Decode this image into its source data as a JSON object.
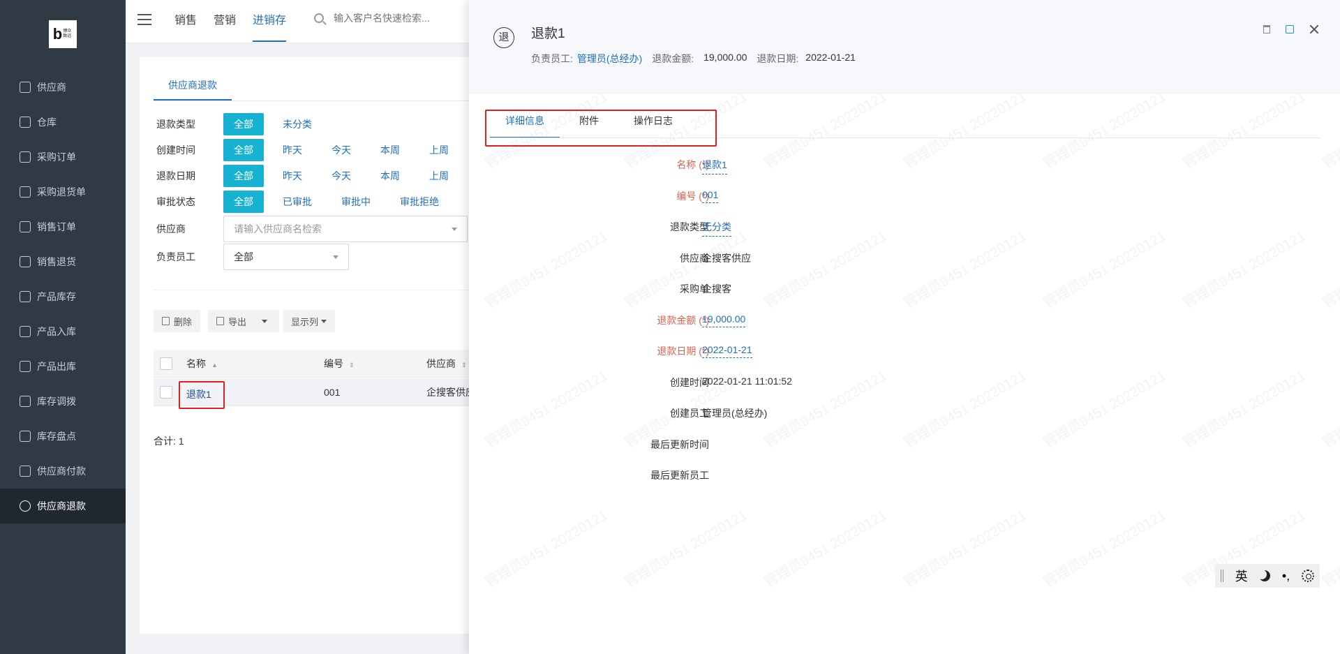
{
  "logo": {
    "mark": "b",
    "text": "博众\n致远"
  },
  "sidebar": {
    "items": [
      {
        "label": "供应商"
      },
      {
        "label": "仓库"
      },
      {
        "label": "采购订单"
      },
      {
        "label": "采购退货单"
      },
      {
        "label": "销售订单"
      },
      {
        "label": "销售退货"
      },
      {
        "label": "产品库存"
      },
      {
        "label": "产品入库"
      },
      {
        "label": "产品出库"
      },
      {
        "label": "库存调拨"
      },
      {
        "label": "库存盘点"
      },
      {
        "label": "供应商付款"
      },
      {
        "label": "供应商退款"
      }
    ],
    "active_index": 12
  },
  "topbar": {
    "tabs": [
      {
        "label": "销售"
      },
      {
        "label": "营销"
      },
      {
        "label": "进销存"
      }
    ],
    "active_tab": 2,
    "search_placeholder": "输入客户名快速检索..."
  },
  "page": {
    "tab_label": "供应商退款",
    "filters": {
      "refund_type": {
        "label": "退款类型",
        "options": [
          "全部",
          "未分类"
        ]
      },
      "created_time": {
        "label": "创建时间",
        "options": [
          "全部",
          "昨天",
          "今天",
          "本周",
          "上周"
        ]
      },
      "refund_date": {
        "label": "退款日期",
        "options": [
          "全部",
          "昨天",
          "今天",
          "本周",
          "上周"
        ]
      },
      "approval_status": {
        "label": "审批状态",
        "options": [
          "全部",
          "已审批",
          "审批中",
          "审批拒绝"
        ]
      },
      "supplier": {
        "label": "供应商",
        "placeholder": "请输入供应商名检索"
      },
      "owner": {
        "label": "负责员工",
        "value": "全部"
      }
    },
    "actions": {
      "delete": "删除",
      "export": "导出",
      "columns": "显示列"
    },
    "table": {
      "headers": [
        "名称",
        "编号",
        "供应商"
      ],
      "rows": [
        {
          "name": "退款1",
          "code": "001",
          "supplier": "企搜客供应"
        }
      ]
    },
    "total": "合计:  1"
  },
  "drawer": {
    "avatar_char": "退",
    "title": "退款1",
    "meta": {
      "owner_label": "负责员工:",
      "owner_value": "管理员(总经办)",
      "amount_label": "退款金额:",
      "amount_value": "19,000.00",
      "date_label": "退款日期:",
      "date_value": "2022-01-21"
    },
    "tabs": [
      {
        "label": "详细信息"
      },
      {
        "label": "附件"
      },
      {
        "label": "操作日志"
      }
    ],
    "active_tab": 0,
    "fields": [
      {
        "label": "名称 (*)",
        "value": "退款1",
        "required": true,
        "editable": true
      },
      {
        "label": "编号 (*)",
        "value": "001",
        "required": true,
        "editable": true
      },
      {
        "label": "退款类型",
        "value": "无分类",
        "required": false,
        "editable": true
      },
      {
        "label": "供应商",
        "value": "企搜客供应",
        "required": false,
        "editable": false
      },
      {
        "label": "采购单",
        "value": "企搜客",
        "required": false,
        "editable": false
      },
      {
        "label": "退款金额 (*)",
        "value": "19,000.00",
        "required": true,
        "editable": true
      },
      {
        "label": "退款日期 (*)",
        "value": "2022-01-21",
        "required": true,
        "editable": true
      },
      {
        "label": "创建时间",
        "value": "2022-01-21 11:01:52",
        "required": false,
        "editable": false
      },
      {
        "label": "创建员工",
        "value": "管理员(总经办)",
        "required": false,
        "editable": false
      },
      {
        "label": "最后更新时间",
        "value": "",
        "required": false,
        "editable": false
      },
      {
        "label": "最后更新员工",
        "value": "",
        "required": false,
        "editable": false
      }
    ],
    "watermark_text": "管理员9451 20220121"
  },
  "ime": {
    "lang": "英",
    "punct": "•,",
    "icons": [
      "moon-icon",
      "gear-icon"
    ]
  },
  "colors": {
    "accent": "#1f6fbf",
    "chip_active": "#17b2d2",
    "highlight": "#e02020",
    "required": "#e0614f"
  }
}
